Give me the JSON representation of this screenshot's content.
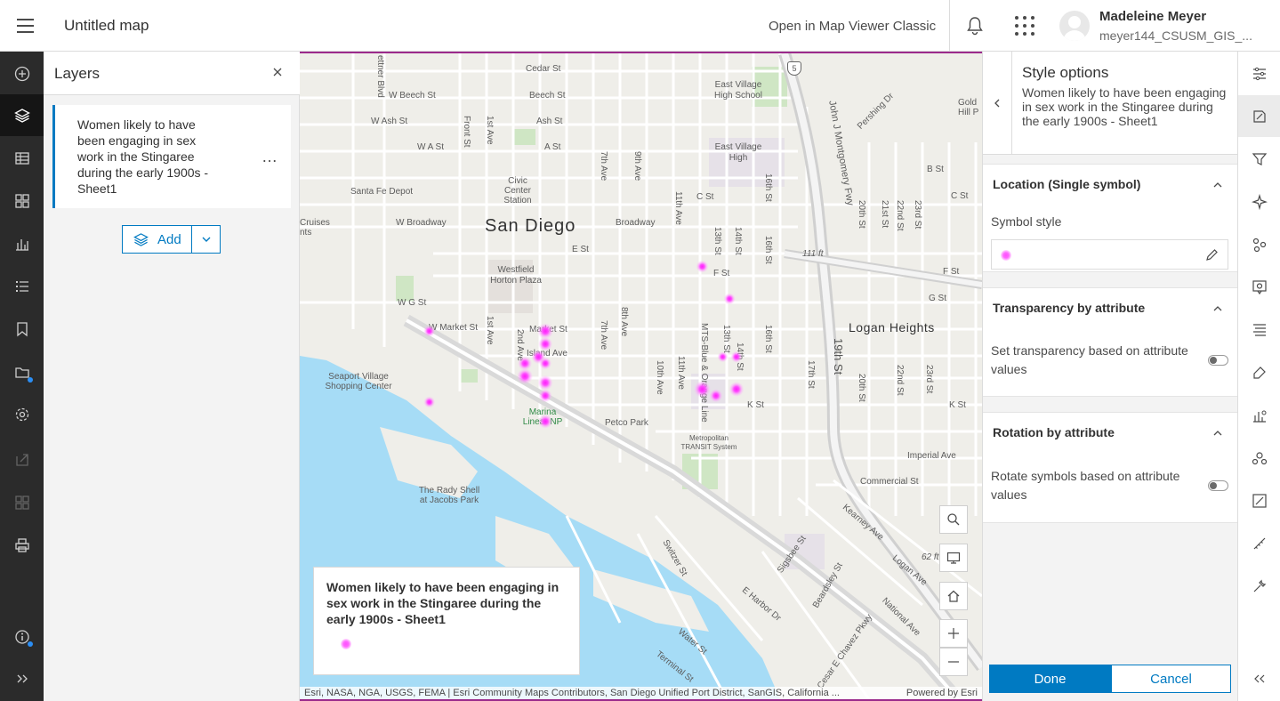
{
  "header": {
    "menu_icon": "hamburger-menu-icon",
    "title": "Untitled map",
    "open_classic": "Open in Map Viewer Classic",
    "notifications_icon": "bell-icon",
    "apps_icon": "app-launcher-grid-icon",
    "user_name": "Madeleine Meyer",
    "user_id": "meyer144_CSUSM_GIS_..."
  },
  "left_rail": {
    "items": [
      "add-layer-icon",
      "layers-icon",
      "tables-icon",
      "basemap-icon",
      "charts-icon",
      "legend-icon",
      "bookmarks-icon",
      "save-icon",
      "settings-icon",
      "share-icon",
      "create-app-icon",
      "print-icon",
      "info-icon",
      "expand-icon"
    ]
  },
  "layers": {
    "title": "Layers",
    "layer_name": "Women likely to have been engaging in sex work in the Stingaree during the early 1900s - Sheet1",
    "more_label": "…",
    "add_label": "Add"
  },
  "map": {
    "labels": {
      "city": "San Diego",
      "logan": "Logan Heights",
      "east_village_hs": "East Village High School",
      "east_village": "East Village High",
      "santa_fe": "Santa Fe Depot",
      "civic": "Civic Center Station",
      "westfield": "Westfield Horton Plaza",
      "seaport": "Seaport Village Shopping Center",
      "marina": "Marina Linear NP",
      "petco": "Petco Park",
      "mts": "Metropolitan TRANSIT System",
      "rady": "The Rady Shell at Jacobs Park",
      "cruises": "Cruises nts",
      "gold_hill": "Gold Hill P",
      "cedar": "Cedar St",
      "beech": "Beech St",
      "w_beech": "W Beech St",
      "w_ash": "W Ash St",
      "ash": "Ash St",
      "w_a": "W A St",
      "a_st": "A St",
      "broadway": "Broadway",
      "w_broadway": "W Broadway",
      "e_st": "E St",
      "f_st": "F St",
      "g_st": "G St",
      "w_g": "W G St",
      "w_market": "W Market St",
      "market": "Market St",
      "island": "Island Ave",
      "k_st": "K St",
      "c_st": "C St",
      "b_st": "B St",
      "imperial": "Imperial Ave",
      "commercial": "Commercial St",
      "front": "Front St",
      "first": "1st Ave",
      "second": "2nd Ave",
      "seventh": "7th Ave",
      "eighth": "8th Ave",
      "ninth": "9th Ave",
      "tenth": "10th Ave",
      "eleventh": "11th Ave",
      "thirteenth": "13th St",
      "fourteenth": "14th St",
      "sixteenth": "16th St",
      "seventeenth": "17th St",
      "nineteenth": "19th St",
      "twentieth": "20th St",
      "twentysecond": "22nd St",
      "twentythird": "23rd St",
      "twentyfirst": "21st St",
      "twentieth2": "20th St",
      "j_montgomery": "John J Montgomery Fwy",
      "kearney": "Kearney Ave",
      "logan_ave": "Logan Ave",
      "national": "National Ave",
      "sigsbee": "Sigsbee St",
      "beardsley": "Beardsley St",
      "e_harbor": "E Harbor Dr",
      "chavez": "Cesar E Chavez Pkwy",
      "switzer": "Switzer St",
      "water": "Water St",
      "terminal": "Terminal St",
      "pershing": "Pershing Dr",
      "mts_line": "MTS-Blue & Orange Line",
      "elev1": "111 ft",
      "elev2": "62 ft",
      "i5": "5",
      "kettner": "ettner Blvd"
    },
    "points": [
      {
        "x": 0.59,
        "y": 0.33,
        "size": 10
      },
      {
        "x": 0.63,
        "y": 0.38,
        "size": 9
      },
      {
        "x": 0.19,
        "y": 0.43,
        "size": 9
      },
      {
        "x": 0.36,
        "y": 0.43,
        "size": 14
      },
      {
        "x": 0.36,
        "y": 0.45,
        "size": 12
      },
      {
        "x": 0.35,
        "y": 0.47,
        "size": 12
      },
      {
        "x": 0.33,
        "y": 0.48,
        "size": 12
      },
      {
        "x": 0.36,
        "y": 0.48,
        "size": 10
      },
      {
        "x": 0.33,
        "y": 0.5,
        "size": 14
      },
      {
        "x": 0.36,
        "y": 0.51,
        "size": 13
      },
      {
        "x": 0.36,
        "y": 0.53,
        "size": 11
      },
      {
        "x": 0.19,
        "y": 0.54,
        "size": 9
      },
      {
        "x": 0.36,
        "y": 0.57,
        "size": 12
      },
      {
        "x": 0.59,
        "y": 0.52,
        "size": 15
      },
      {
        "x": 0.61,
        "y": 0.53,
        "size": 11
      },
      {
        "x": 0.64,
        "y": 0.52,
        "size": 13
      },
      {
        "x": 0.64,
        "y": 0.47,
        "size": 9
      },
      {
        "x": 0.62,
        "y": 0.47,
        "size": 8
      }
    ],
    "tools": [
      "search-icon",
      "screen-icon",
      "home-icon",
      "zoom-in-icon",
      "zoom-out-icon"
    ],
    "legend_title": "Women likely to have been engaging in sex work in the Stingaree during the early 1900s - Sheet1",
    "attribution": "Esri, NASA, NGA, USGS, FEMA | Esri Community Maps Contributors, San Diego Unified Port District, SanGIS, California ...",
    "powered_by": "Powered by Esri"
  },
  "style_panel": {
    "title": "Style options",
    "subtitle": "Women likely to have been engaging in sex work in the Stingaree during the early 1900s - Sheet1",
    "location_title": "Location (Single symbol)",
    "symbol_style_label": "Symbol style",
    "transparency_title": "Transparency by attribute",
    "transparency_text": "Set transparency based on attribute values",
    "rotation_title": "Rotation by attribute",
    "rotation_text": "Rotate symbols based on attribute values",
    "transparency_on": false,
    "rotation_on": false,
    "done_label": "Done",
    "cancel_label": "Cancel"
  },
  "right_rail": {
    "items": [
      "properties-icon",
      "styles-icon",
      "filter-icon",
      "effects-icon",
      "pop-ups-icon",
      "configure-pop-ups-icon",
      "labels-icon",
      "edit-icon",
      "analysis-icon",
      "cluster-icon",
      "sketch-icon",
      "measure-icon",
      "tools-icon",
      "collapse-icon"
    ]
  },
  "colors": {
    "accent": "#007ac2",
    "point": "#ff3cff",
    "water": "#a6dcf6",
    "frame": "#9b2a8b"
  }
}
